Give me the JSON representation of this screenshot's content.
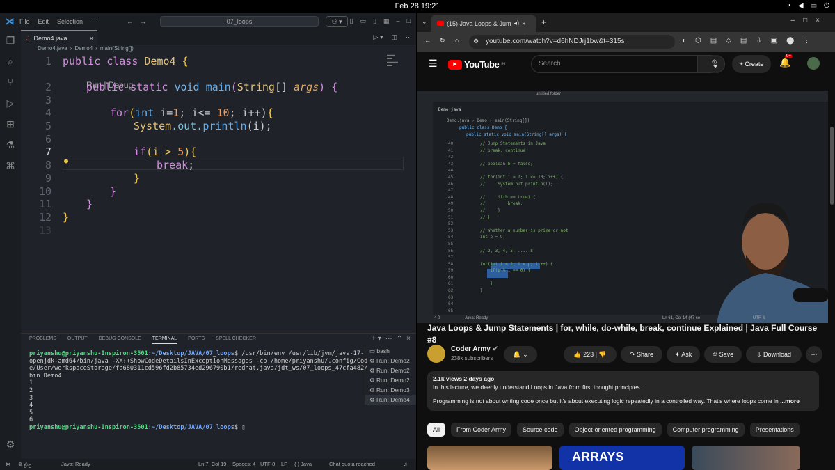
{
  "system": {
    "clock": "Feb 28  19:21",
    "tray": [
      "wifi",
      "volume",
      "battery",
      "power"
    ]
  },
  "vscode": {
    "menus": [
      "File",
      "Edit",
      "Selection"
    ],
    "search": "07_loops",
    "tab": {
      "name": "Demo4.java",
      "icon": "J"
    },
    "breadcrumb": [
      "Demo4.java",
      "Demo4",
      "main(String[])"
    ],
    "codelens": "Run | Debug",
    "lines": [
      1,
      2,
      3,
      4,
      5,
      6,
      7,
      8,
      9,
      10,
      11,
      12,
      13
    ],
    "code": {
      "l1a": "public",
      "l1b": "class",
      "l1c": "Demo4",
      "l1d": "{",
      "l2a": "public",
      "l2b": "static",
      "l2c": "void",
      "l2d": "main",
      "l2e": "(",
      "l2f": "String",
      "l2g": "[]",
      "l2h": "args",
      "l2i": ")",
      "l2j": "{",
      "l4a": "for",
      "l4b": "(",
      "l4c": "int",
      "l4d": "i=",
      "l4e": "1",
      "l4f": "; i<= ",
      "l4g": "10",
      "l4h": "; i++)",
      "l4i": "{",
      "l5a": "System",
      "l5b": ".out.",
      "l5c": "println",
      "l5d": "(i);",
      "l7a": "if",
      "l7b": "(i > ",
      "l7c": "5",
      "l7d": ")",
      "l7e": "{",
      "l8a": "break",
      "l8b": ";",
      "l9": "}",
      "l10": "}",
      "l11": "}",
      "l12": "}"
    },
    "panel_tabs": [
      "PROBLEMS",
      "OUTPUT",
      "DEBUG CONSOLE",
      "TERMINAL",
      "PORTS",
      "SPELL CHECKER"
    ],
    "terminal": {
      "prompt_user": "priyanshu@priyanshu-Inspiron-3501",
      "prompt_path": ":~/Desktop/JAVA/07_loops",
      "command": "$ /usr/bin/env /usr/lib/jvm/java-17-\nopenjdk-amd64/bin/java -XX:+ShowCodeDetailsInExceptionMessages -cp /home/priyanshu/.config/Cod\ne/User/workspaceStorage/fa680311cd596fd2b85734ed296790b1/redhat.java/jdt_ws/07_loops_47cfa482/\nbin Demo4",
      "output": "1\n2\n3\n4\n5\n6",
      "prompt2_end": "$ "
    },
    "terminal_list": [
      "bash",
      "Run: Demo2",
      "Run: Demo2",
      "Run: Demo2",
      "Run: Demo3",
      "Run: Demo4"
    ],
    "status": {
      "errors": "0",
      "warnings": "0",
      "java": "Java: Ready",
      "position": "Ln 7, Col 19",
      "spaces": "Spaces: 4",
      "encoding": "UTF-8",
      "eol": "LF",
      "lang": "{ }  Java",
      "quota": "Chat quota reached"
    }
  },
  "chrome": {
    "tab_title": "(15) Java Loops & Jum",
    "url": "youtube.com/watch?v=d6hNDJrj1bw&t=315s",
    "yt": {
      "logo": "YouTube",
      "region": "IN",
      "search_placeholder": "Search",
      "create": "Create",
      "notif": "9+",
      "video_title": "Java Loops & Jump Statements | for, while, do-while, break, continue Explained | Java Full Course #8",
      "channel": "Coder Army",
      "subs": "238k subscribers",
      "likes": "223",
      "share": "Share",
      "ask": "Ask",
      "save": "Save",
      "download": "Download",
      "views": "2.1k views  2 days ago",
      "desc1": "In this lecture, we deeply understand Loops in Java from first thought principles.",
      "desc2": "Programming is not about writing code once but it's about executing logic repeatedly in a controlled way. That's where loops come in",
      "more": "...more",
      "chips": [
        "All",
        "From Coder Army",
        "Source code",
        "Object-oriented programming",
        "Computer programming",
        "Presentations"
      ],
      "thumb2_text": "ARRAYS"
    },
    "inner": {
      "folder": "untitled folder",
      "tab": "Demo.java",
      "bread": [
        "Demo.java",
        "Demo",
        "main(String[])"
      ],
      "head1": "public class Demo {",
      "head2": "public static void main(String[] args) {",
      "lines": [
        "40",
        "41",
        "42",
        "43",
        "44",
        "45",
        "46",
        "47",
        "48",
        "49",
        "50",
        "51",
        "52",
        "53",
        "54",
        "55",
        "56",
        "57",
        "58",
        "59",
        "60",
        "61",
        "62",
        "63",
        "64",
        "65"
      ],
      "code": [
        "// Jump Statements in Java",
        "// break, continue",
        "",
        "// boolean b = false;",
        "",
        "// for(int i = 1; i <= 10; i++) {",
        "//     System.out.println(i);",
        "",
        "//     if(b == true) {",
        "//         break;",
        "//     }",
        "// }",
        "",
        "// Whether a number is prime or not",
        "int p = 9;",
        "",
        "// 2, 3, 4, 5, .... 8",
        "",
        "for(int i = 2; i < p; i ++) {",
        "    if(p % i == 0) {",
        "",
        "    }",
        "}",
        "",
        "",
        ""
      ],
      "status_left": "4  0",
      "status_java": "Java: Ready",
      "status_right": "Ln 61, Col 14 (47 se",
      "enc": "UTF-8"
    }
  }
}
